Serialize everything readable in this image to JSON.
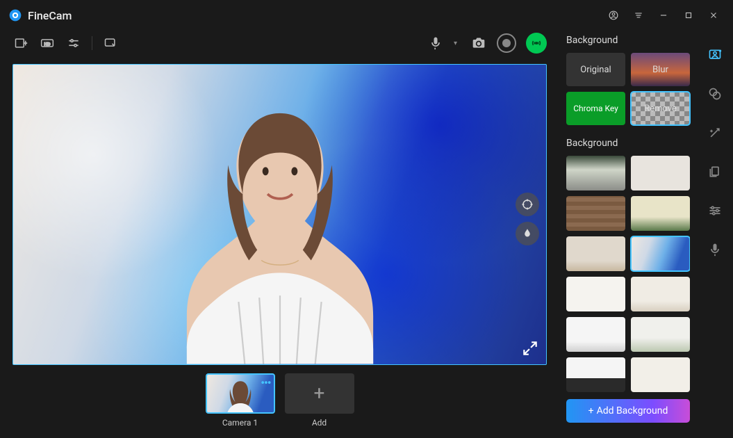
{
  "app": {
    "title": "FineCam"
  },
  "panel": {
    "background_modes_title": "Background",
    "modes": {
      "original": "Original",
      "blur": "Blur",
      "chroma": "Chroma Key",
      "remove": "Remove"
    },
    "background_list_title": "Background",
    "add_background": "Add Background"
  },
  "scenes": {
    "camera1": "Camera 1",
    "add": "Add"
  }
}
